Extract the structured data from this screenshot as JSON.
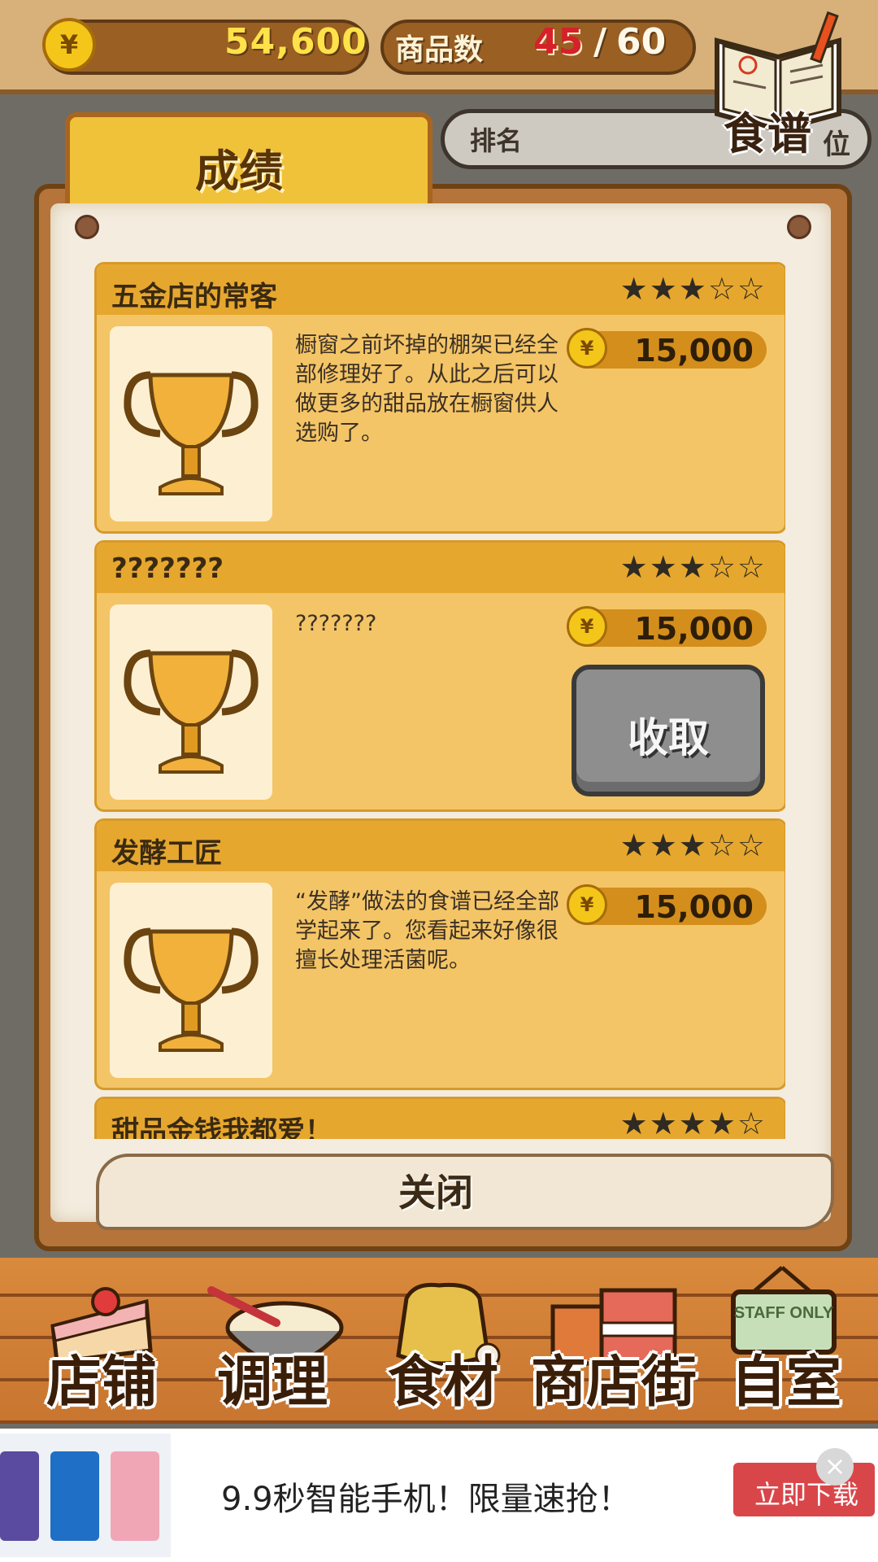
{
  "top": {
    "money": "54,600",
    "coin_symbol": "¥",
    "goods_label": "商品数",
    "goods_current": "45",
    "goods_separator": "/",
    "goods_max": "60"
  },
  "recipe_book_label": "食谱",
  "ranking": {
    "label": "排名",
    "unit": "位"
  },
  "panel": {
    "tab_title": "成绩",
    "entries": [
      {
        "title": "五金店的常客",
        "stars": "★★★☆☆",
        "description": "橱窗之前坏掉的棚架已经全部修理好了。从此之后可以做更多的甜品放在橱窗供人选购了。",
        "reward": "15,000"
      },
      {
        "title": "???????",
        "stars": "★★★☆☆",
        "description": "???????",
        "reward": "15,000",
        "collect_label": "收取"
      },
      {
        "title": "发酵工匠",
        "stars": "★★★☆☆",
        "description": "“发酵”做法的食谱已经全部学起来了。您看起来好像很擅长处理活菌呢。",
        "reward": "15,000"
      },
      {
        "title": "甜品金钱我都爱！",
        "stars": "★★★★☆"
      }
    ],
    "close_label": "关闭"
  },
  "nav": [
    {
      "label": "店铺",
      "icon": "cake-icon"
    },
    {
      "label": "调理",
      "icon": "mixing-bowl-icon"
    },
    {
      "label": "食材",
      "icon": "flour-sack-icon"
    },
    {
      "label": "商店街",
      "icon": "shop-building-icon"
    },
    {
      "label": "自室",
      "icon": "staff-only-sign-icon",
      "sign_text": "STAFF ONLY"
    }
  ],
  "ad": {
    "text": "9.9秒智能手机！限量速抢！",
    "button": "立即下载",
    "close": "×"
  }
}
